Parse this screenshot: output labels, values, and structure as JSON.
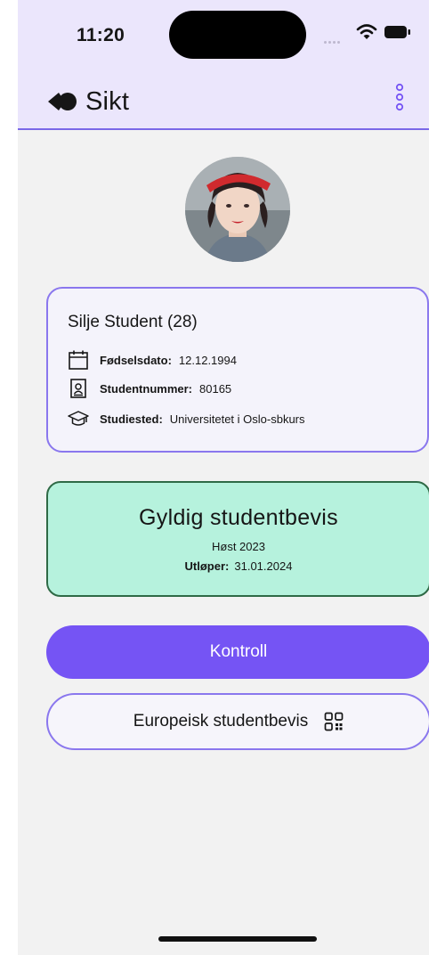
{
  "status_bar": {
    "time": "11:20"
  },
  "header": {
    "app_name": "Sikt",
    "menu_icon": "more-vertical-icon"
  },
  "profile": {
    "name": "Silje Student (28)",
    "rows": [
      {
        "icon": "calendar-icon",
        "label": "Fødselsdato:",
        "value": "12.12.1994"
      },
      {
        "icon": "id-badge-icon",
        "label": "Studentnummer:",
        "value": "80165"
      },
      {
        "icon": "graduation-cap-icon",
        "label": "Studiested:",
        "value": "Universitetet i Oslo-sbkurs"
      }
    ]
  },
  "status": {
    "title": "Gyldig studentbevis",
    "term": "Høst 2023",
    "expiry_label": "Utløper:",
    "expiry_value": "31.01.2024"
  },
  "buttons": {
    "primary": "Kontroll",
    "secondary": "Europeisk studentbevis",
    "secondary_icon": "qr-code-icon"
  },
  "colors": {
    "accent": "#7554f4",
    "header_bg": "#ebe6fc",
    "valid_bg": "#b6f2dd",
    "valid_border": "#2f6a46"
  }
}
